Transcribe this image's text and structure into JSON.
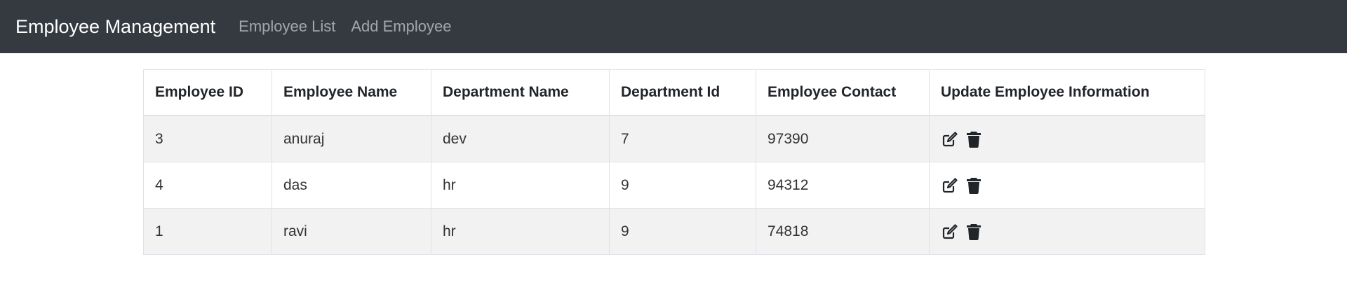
{
  "navbar": {
    "brand": "Employee Management",
    "links": [
      "Employee List",
      "Add Employee"
    ]
  },
  "table": {
    "headers": [
      "Employee ID",
      "Employee Name",
      "Department Name",
      "Department Id",
      "Employee Contact",
      "Update Employee Information"
    ],
    "rows": [
      {
        "id": "3",
        "name": "anuraj",
        "dept_name": "dev",
        "dept_id": "7",
        "contact": "97390",
        "actions": [
          "edit-icon",
          "trash-icon"
        ]
      },
      {
        "id": "4",
        "name": "das",
        "dept_name": "hr",
        "dept_id": "9",
        "contact": "94312",
        "actions": [
          "edit-icon",
          "trash-icon"
        ]
      },
      {
        "id": "1",
        "name": "ravi",
        "dept_name": "hr",
        "dept_id": "9",
        "contact": "74818",
        "actions": [
          "edit-icon",
          "trash-icon"
        ]
      }
    ]
  },
  "colors": {
    "navbar_bg": "#343a40",
    "stripe_bg": "#f2f2f2",
    "border": "#dee2e6"
  }
}
